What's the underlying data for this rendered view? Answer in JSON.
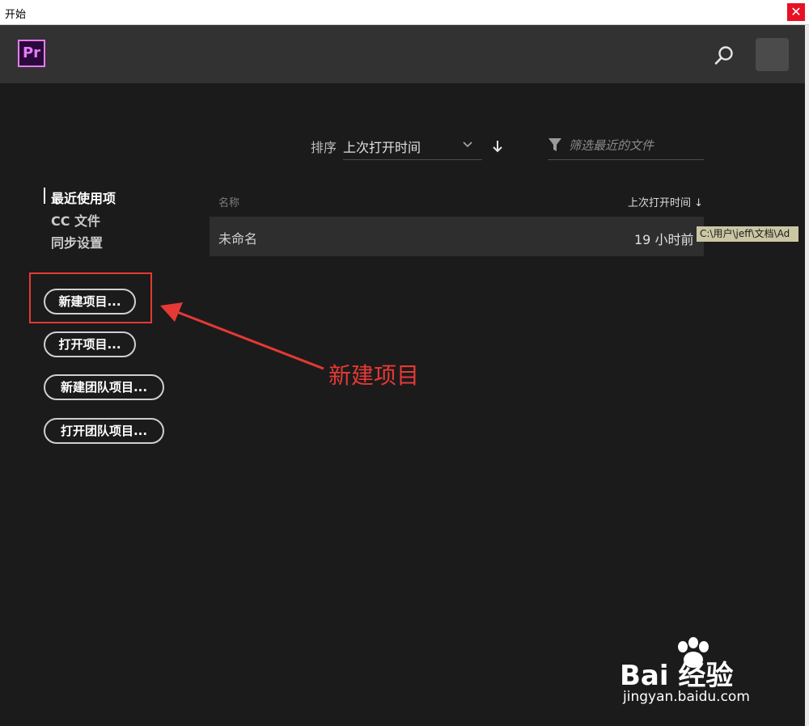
{
  "window": {
    "title": "开始",
    "close_label": "✕"
  },
  "header": {
    "logo_text": "Pr",
    "search_icon": "search-icon",
    "brand_color": "#e77bf9"
  },
  "sort": {
    "label": "排序",
    "selected": "上次打开时间",
    "direction_icon": "arrow-down-icon"
  },
  "filter": {
    "placeholder": "筛选最近的文件"
  },
  "nav": {
    "items": [
      {
        "label": "最近使用项",
        "active": true
      },
      {
        "label": "CC 文件"
      },
      {
        "label": "同步设置"
      }
    ]
  },
  "buttons": {
    "new_project": "新建项目...",
    "open_project": "打开项目...",
    "new_team_project": "新建团队项目...",
    "open_team_project": "打开团队项目..."
  },
  "table": {
    "col_name": "名称",
    "col_time": "上次打开时间 ↓",
    "rows": [
      {
        "name": "未命名",
        "time": "19 小时前"
      }
    ]
  },
  "tooltip": "C:\\用户\\jeff\\文档\\Ad",
  "annotation": {
    "text": "新建项目",
    "color": "#e53935"
  },
  "watermark": {
    "main": "Bai 经验",
    "sub": "jingyan.baidu.com"
  }
}
